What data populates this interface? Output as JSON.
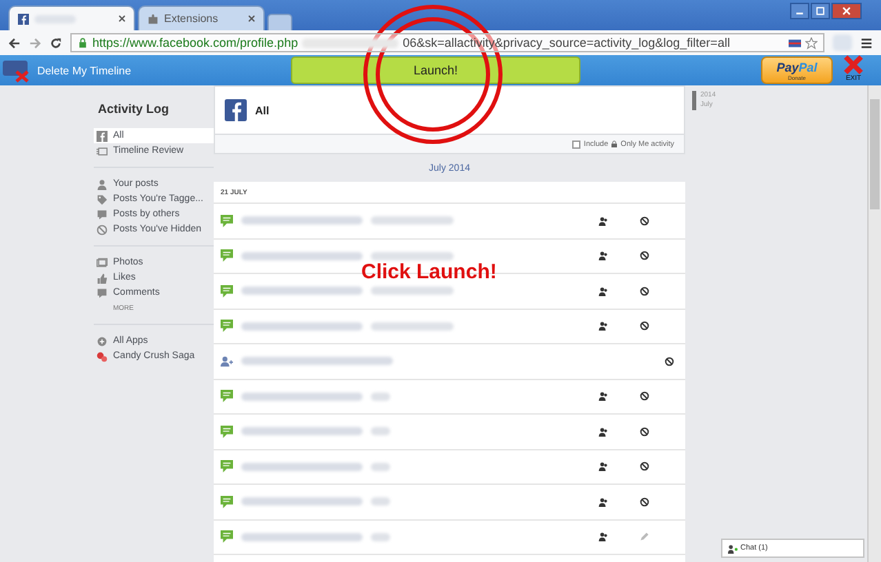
{
  "browser": {
    "tabs": [
      {
        "kind": "facebook",
        "selected": true
      },
      {
        "kind": "extension",
        "label": "Extensions",
        "selected": false
      }
    ],
    "address": {
      "start": "https://www.facebook.com/profile.php",
      "end": "06&sk=allactivity&privacy_source=activity_log&log_filter=all"
    }
  },
  "extension_bar": {
    "title": "Delete My Timeline",
    "launch": "Launch!",
    "paypal": {
      "brand_a": "Pay",
      "brand_b": "Pal",
      "caption": "Donate"
    },
    "exit": "EXIT"
  },
  "annotation": {
    "text": "Click Launch!"
  },
  "sidebar": {
    "title": "Activity Log",
    "groups": [
      [
        {
          "kind": "item",
          "label": "All",
          "selected": true
        },
        {
          "kind": "item",
          "label": "Timeline Review",
          "selected": false
        }
      ],
      [
        {
          "kind": "item",
          "label": "Your posts",
          "selected": false
        },
        {
          "kind": "item",
          "label": "Posts You're Tagge...",
          "selected": false
        },
        {
          "kind": "item",
          "label": "Posts by others",
          "selected": false
        },
        {
          "kind": "item",
          "label": "Posts You've Hidden",
          "selected": false
        }
      ],
      [
        {
          "kind": "item",
          "label": "Photos",
          "selected": false
        },
        {
          "kind": "item",
          "label": "Likes",
          "selected": false
        },
        {
          "kind": "item",
          "label": "Comments",
          "selected": false
        },
        {
          "kind": "more",
          "label": "MORE",
          "selected": false
        }
      ],
      [
        {
          "kind": "item",
          "label": "All Apps",
          "selected": false
        },
        {
          "kind": "item",
          "label": "Candy Crush Saga",
          "selected": false
        }
      ]
    ]
  },
  "feed": {
    "title": "All",
    "filter": {
      "label_a": "Include",
      "label_b": "Only Me activity",
      "checked": false
    },
    "month": "July 2014",
    "day": "21 JULY",
    "rows": [
      {
        "kind": "comment"
      },
      {
        "kind": "comment"
      },
      {
        "kind": "comment"
      },
      {
        "kind": "comment"
      },
      {
        "kind": "friend"
      },
      {
        "kind": "comment"
      },
      {
        "kind": "comment"
      },
      {
        "kind": "comment"
      },
      {
        "kind": "comment"
      },
      {
        "kind": "editable"
      }
    ]
  },
  "timeline": {
    "year": "2014",
    "month": "July"
  },
  "chat": {
    "label": "Chat (1)"
  }
}
